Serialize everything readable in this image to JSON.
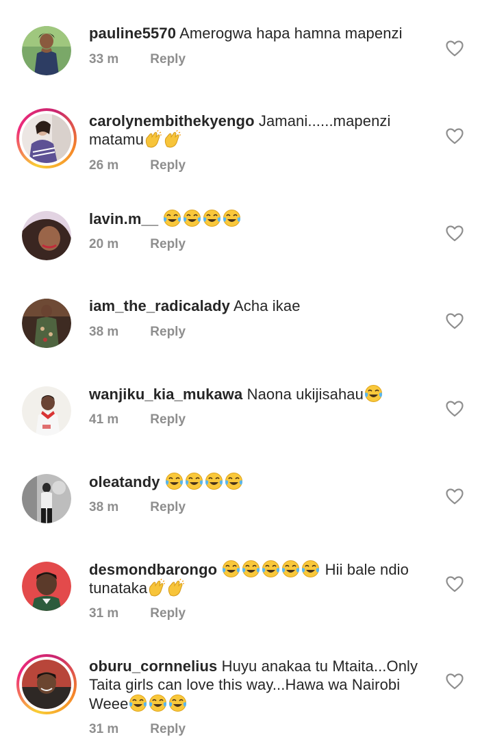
{
  "comments": [
    {
      "username": "pauline5570",
      "text": "Amerogwa hapa hamna mapenzi",
      "time": "33 m",
      "reply": "Reply",
      "story_ring": false,
      "emojis": [],
      "avatar_colors": [
        "#6b9a58",
        "#2d3d63",
        "#caa58a"
      ]
    },
    {
      "username": "carolynembithekyengo",
      "text": "Jamani......mapenzi matamu",
      "time": "26 m",
      "reply": "Reply",
      "story_ring": true,
      "emojis": [
        "clapping-hands",
        "clapping-hands"
      ],
      "avatar_colors": [
        "#e8e1de",
        "#6b5f9e",
        "#d7b39e"
      ]
    },
    {
      "username": "lavin.m__",
      "text": "",
      "time": "20 m",
      "reply": "Reply",
      "story_ring": false,
      "emojis": [
        "face-with-tears-of-joy",
        "face-with-tears-of-joy",
        "face-with-tears-of-joy",
        "face-with-tears-of-joy"
      ],
      "avatar_colors": [
        "#d9c5d9",
        "#3b2723",
        "#8c5a44"
      ]
    },
    {
      "username": "iam_the_radicalady",
      "text": "Acha ikae",
      "time": "38 m",
      "reply": "Reply",
      "story_ring": false,
      "emojis": [],
      "avatar_colors": [
        "#3e2b22",
        "#5f7049",
        "#b59a7c"
      ]
    },
    {
      "username": "wanjiku_kia_mukawa",
      "text": "Naona ukijisahau",
      "time": "41 m",
      "reply": "Reply",
      "story_ring": false,
      "emojis": [
        "face-with-tears-of-joy"
      ],
      "avatar_colors": [
        "#f1efe9",
        "#d63334",
        "#5a3b2c"
      ]
    },
    {
      "username": "oleatandy",
      "text": "",
      "time": "38 m",
      "reply": "Reply",
      "story_ring": false,
      "emojis": [
        "face-with-tears-of-joy",
        "face-with-tears-of-joy",
        "face-with-tears-of-joy",
        "face-with-tears-of-joy"
      ],
      "avatar_colors": [
        "#bfbfbf",
        "#1f1f1f",
        "#7a7a7a"
      ]
    },
    {
      "username": "desmondbarongo",
      "text": "Hii bale ndio tunataka",
      "time": "31 m",
      "reply": "Reply",
      "story_ring": false,
      "emojis": [
        "face-with-tears-of-joy",
        "face-with-tears-of-joy",
        "face-with-tears-of-joy",
        "face-with-tears-of-joy",
        "face-with-tears-of-joy",
        "clapping-hands",
        "clapping-hands"
      ],
      "avatar_colors": [
        "#e04748",
        "#2b5a3a",
        "#5a3a2a"
      ]
    },
    {
      "username": "oburu_cornnelius",
      "text": "Huyu anakaa tu Mtaita...Only Taita girls can love this way...Hawa wa Nairobi Weee",
      "time": "31 m",
      "reply": "Reply",
      "story_ring": true,
      "emojis": [
        "face-with-tears-of-joy",
        "face-with-tears-of-joy",
        "face-with-tears-of-joy"
      ],
      "avatar_colors": [
        "#c64b3a",
        "#2f2a27",
        "#6e4a34"
      ]
    }
  ],
  "icons": {
    "like": "heart-outline-icon",
    "laugh": "face-with-tears-of-joy",
    "clap": "clapping-hands"
  },
  "colors": {
    "text": "#262626",
    "meta": "#8e8e8e",
    "heart_outline": "#8e8e8e",
    "story_ring_start": "#f9ce34",
    "story_ring_end": "#ee2a7b"
  }
}
